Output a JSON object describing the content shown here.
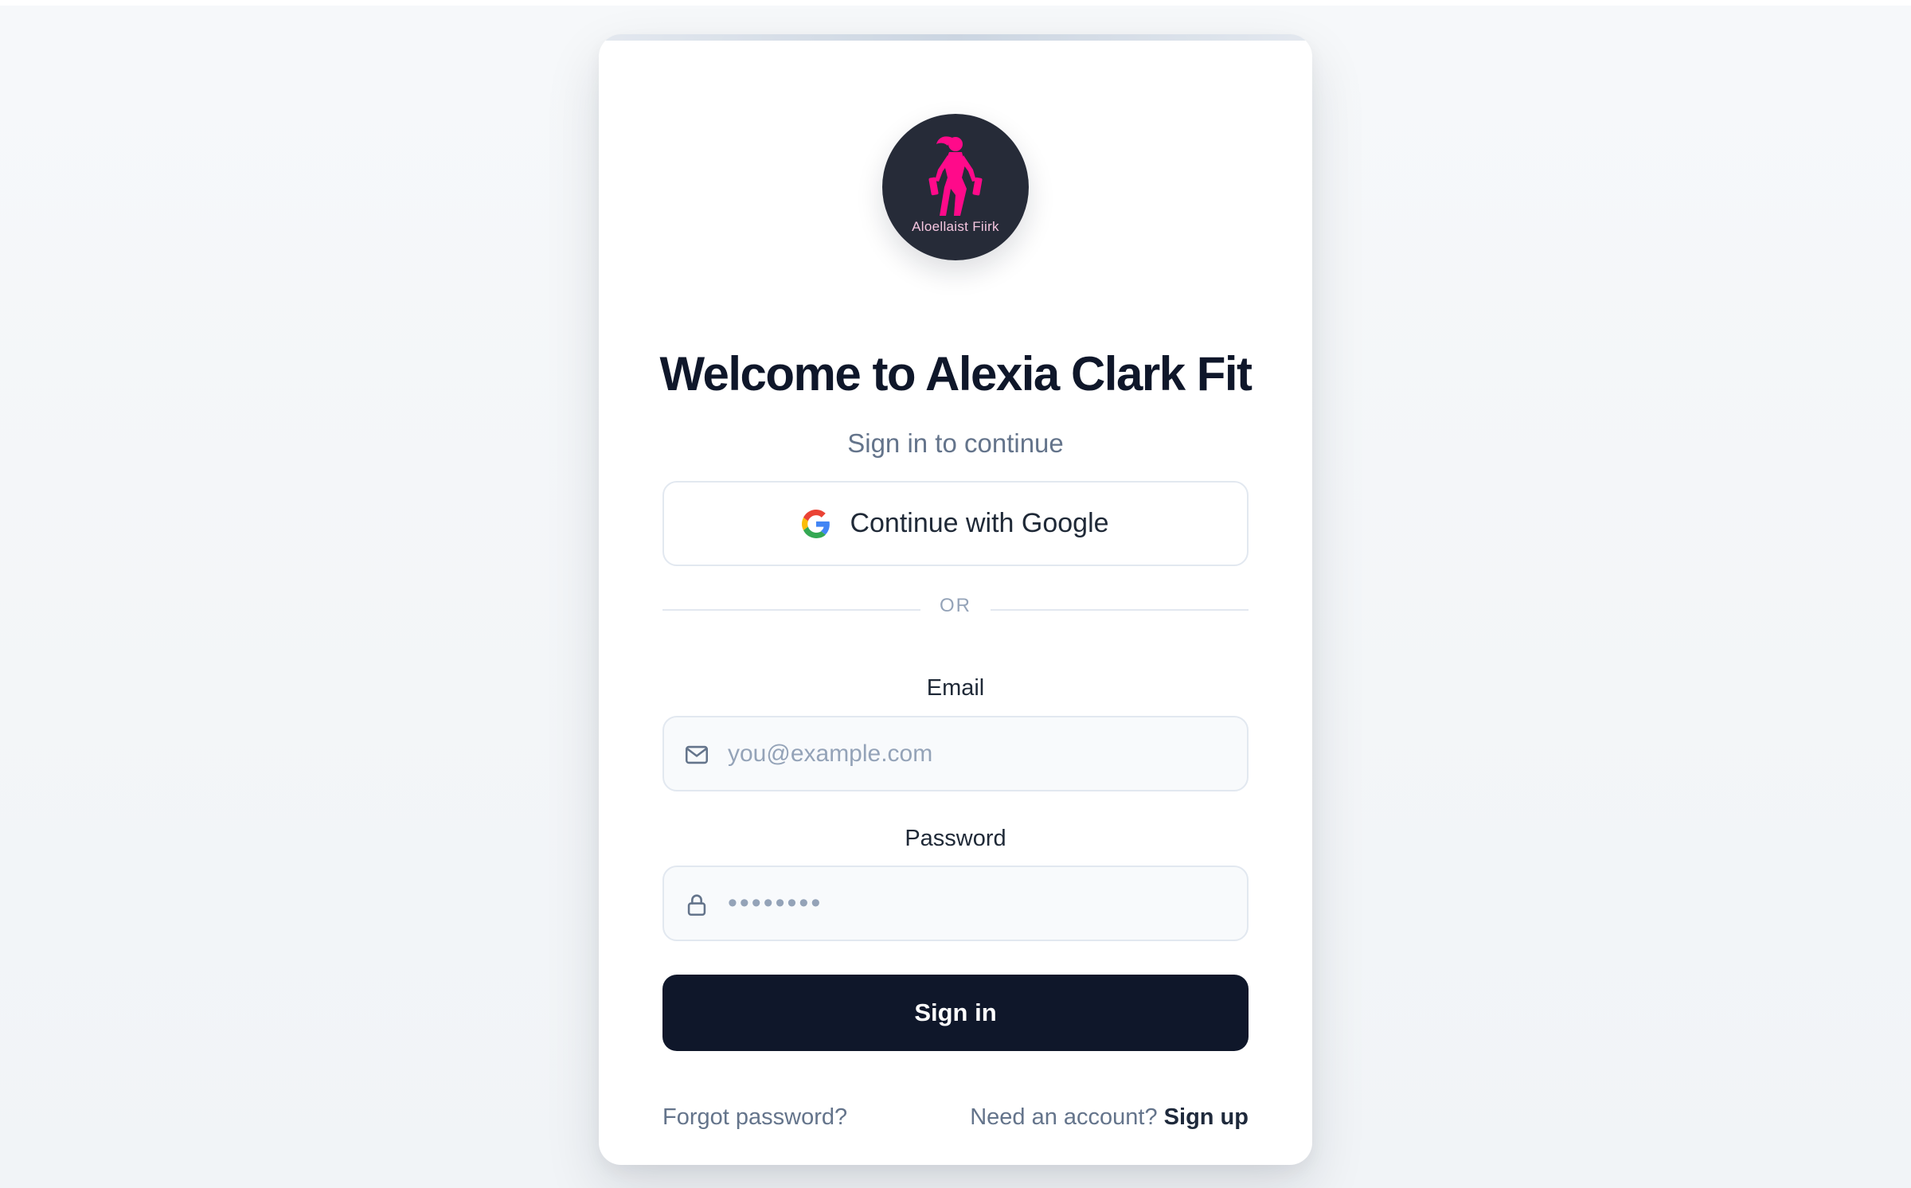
{
  "logo": {
    "text": "Aloellaist Fiirk",
    "background_color": "#262b38",
    "figure_color": "#ff0a8a",
    "icon": "fitness-woman-dumbbells-icon"
  },
  "header": {
    "title": "Welcome to Alexia Clark Fit",
    "subtitle": "Sign in to continue"
  },
  "google_button": {
    "label": "Continue with Google",
    "icon": "google-g-icon"
  },
  "divider": {
    "label": "OR"
  },
  "email": {
    "label": "Email",
    "placeholder": "you@example.com",
    "value": "",
    "icon": "mail-icon"
  },
  "password": {
    "label": "Password",
    "masked_value": "••••••••",
    "icon": "lock-icon"
  },
  "signin_button": {
    "label": "Sign in",
    "color": "#0f172a"
  },
  "footer": {
    "forgot_label": "Forgot password?",
    "need_account_label": "Need an account?",
    "signup_label": "Sign up"
  }
}
